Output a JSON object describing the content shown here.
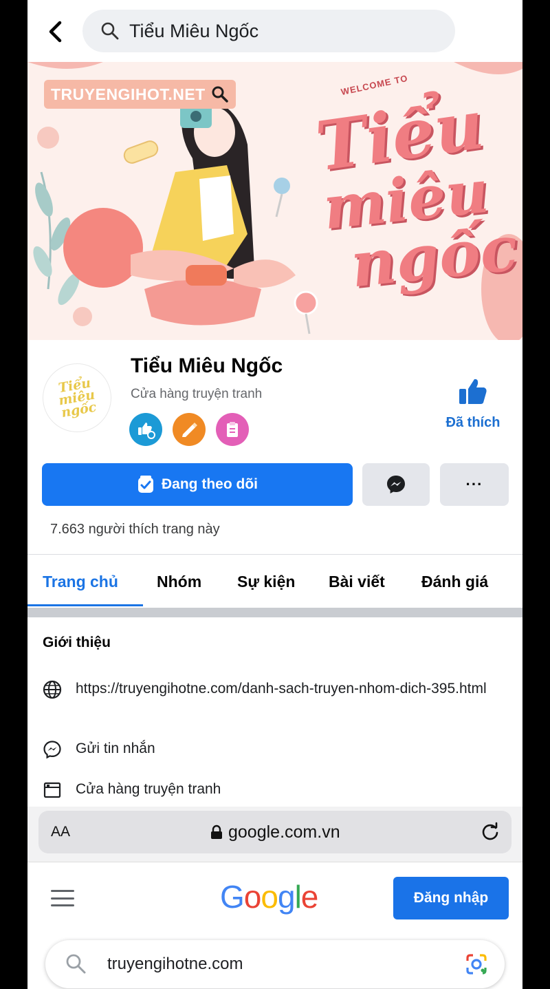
{
  "top_search": {
    "query": "Tiểu Miêu Ngốc"
  },
  "cover": {
    "site_label": "TRUYENGIHOT.NET",
    "welcome": "WELCOME TO",
    "script_line1": "Tiểu",
    "script_line2": "miêu",
    "script_line3": "ngốc"
  },
  "avatar": {
    "text_line1": "Tiểu",
    "text_line2": "miêu",
    "text_line3": "ngốc"
  },
  "page": {
    "name": "Tiểu Miêu Ngốc",
    "category": "Cửa hàng truyện tranh",
    "liked_label": "Đã thích",
    "follow_label": "Đang theo dõi",
    "more_label": "···",
    "likes_text": "7.663 người thích trang này"
  },
  "tabs": [
    "Trang chủ",
    "Nhóm",
    "Sự kiện",
    "Bài viết",
    "Đánh giá"
  ],
  "intro": {
    "title": "Giới thiệu",
    "website": "https://truyengihotne.com/danh-sach-truyen-nhom-dich-395.html",
    "message": "Gửi tin nhắn",
    "category": "Cửa hàng truyện tranh"
  },
  "browser": {
    "aa": "AA",
    "host": "google.com.vn"
  },
  "google": {
    "logo_letters": [
      "G",
      "o",
      "o",
      "g",
      "l",
      "e"
    ],
    "logo_colors": [
      "#4285F4",
      "#EA4335",
      "#FBBC05",
      "#4285F4",
      "#34A853",
      "#EA4335"
    ],
    "signin_label": "Đăng nhập",
    "search_query": "truyengihotne.com"
  },
  "colors": {
    "fb_blue": "#1877f2",
    "google_blue": "#1a73e8"
  }
}
